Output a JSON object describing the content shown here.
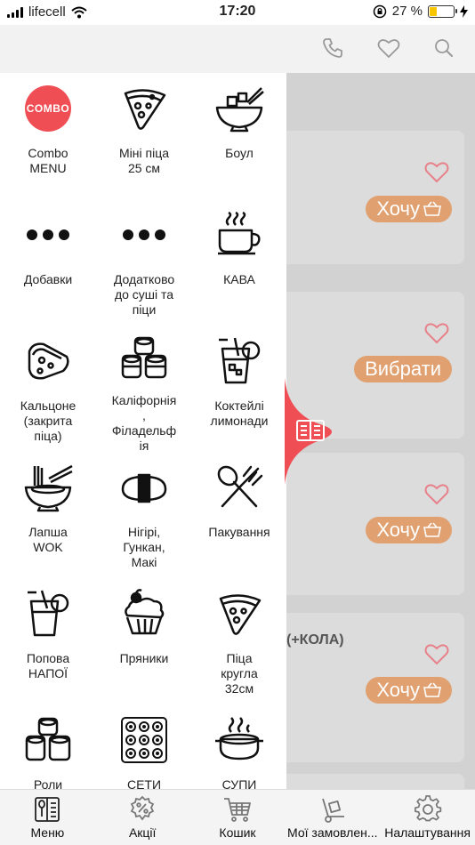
{
  "status_bar": {
    "carrier": "lifecell",
    "time": "17:20",
    "battery": "27 %"
  },
  "categories": [
    {
      "label": "Combo\nMENU",
      "icon": "combo-badge-icon",
      "badge": "COMBO"
    },
    {
      "label": "Міні піца\n25 см",
      "icon": "pizza-slice-icon"
    },
    {
      "label": "Боул",
      "icon": "bowl-icon"
    },
    {
      "label": "Добавки",
      "icon": "dots-icon"
    },
    {
      "label": "Додатково\nдо суші та\nпіци",
      "icon": "dots-icon"
    },
    {
      "label": "КАВА",
      "icon": "coffee-cup-icon"
    },
    {
      "label": "Кальцоне\n(закрита\nпіца)",
      "icon": "calzone-icon"
    },
    {
      "label": "Каліфорнія\n,\nФіладельф\nія",
      "icon": "sushi-rolls-icon"
    },
    {
      "label": "Коктейлі\nлимонади",
      "icon": "lemonade-glass-icon"
    },
    {
      "label": "Лапша\nWOK",
      "icon": "noodles-bowl-icon"
    },
    {
      "label": "Нігірі,\nГункан,\nМакі",
      "icon": "nigiri-icon"
    },
    {
      "label": "Пакування",
      "icon": "spoon-fork-icon"
    },
    {
      "label": "Попова\nНАПОЇ",
      "icon": "soda-glass-icon"
    },
    {
      "label": "Пряники",
      "icon": "cupcake-icon"
    },
    {
      "label": "Піца\nкругла\n32см",
      "icon": "pizza-slice-icon"
    },
    {
      "label": "Роли",
      "icon": "rolls-stack-icon"
    },
    {
      "label": "СЕТИ",
      "icon": "sushi-set-icon"
    },
    {
      "label": "СУПИ",
      "icon": "soup-pot-icon"
    }
  ],
  "cards": [
    {
      "button": "Хочу"
    },
    {
      "button": "Вибрати"
    },
    {
      "button": "Хочу"
    },
    {
      "text": "(+КОЛА)",
      "button": "Хочу"
    }
  ],
  "nav": [
    {
      "label": "Меню",
      "icon": "menu-book-icon"
    },
    {
      "label": "Акції",
      "icon": "percent-gear-icon"
    },
    {
      "label": "Кошик",
      "icon": "cart-icon"
    },
    {
      "label": "Мої замовлен...",
      "icon": "dolly-icon"
    },
    {
      "label": "Налаштування",
      "icon": "settings-gear-icon"
    }
  ],
  "colors": {
    "accent": "#ef4f54",
    "button": "#e0a070",
    "heart": "#e8808a"
  }
}
